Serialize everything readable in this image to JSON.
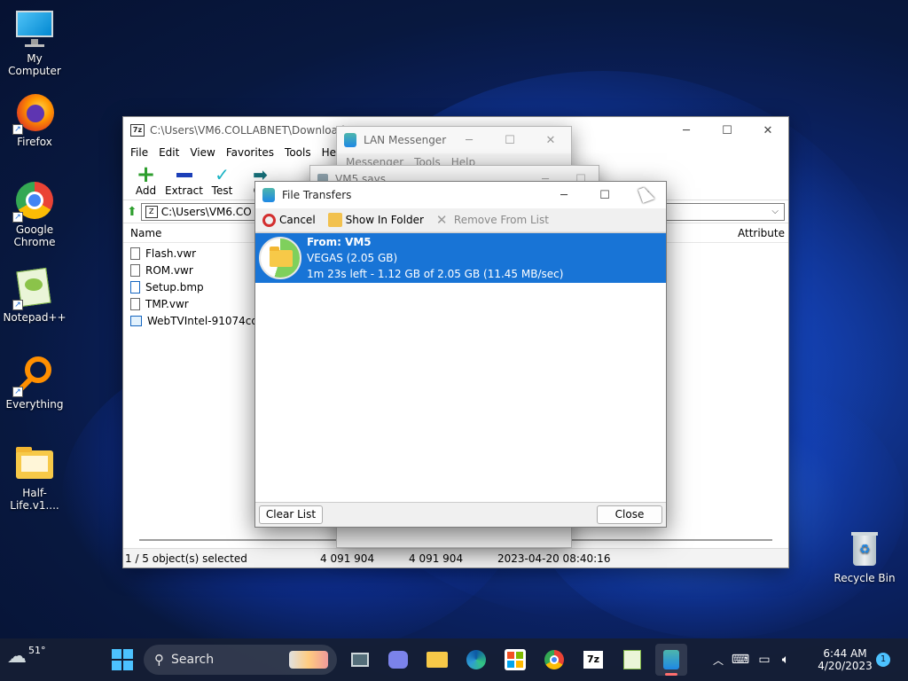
{
  "desktop": {
    "icons": [
      {
        "label": "My Computer"
      },
      {
        "label": "Firefox"
      },
      {
        "label": "Google Chrome"
      },
      {
        "label": "Notepad++"
      },
      {
        "label": "Everything"
      },
      {
        "label": "Half-Life.v1...."
      },
      {
        "label": "Recycle Bin"
      }
    ]
  },
  "sevenzip": {
    "title": "C:\\Users\\VM6.COLLABNET\\Downloads\\W...",
    "menu": [
      "File",
      "Edit",
      "View",
      "Favorites",
      "Tools",
      "Help"
    ],
    "toolbar": [
      "Add",
      "Extract",
      "Test",
      "Co"
    ],
    "address": "C:\\Users\\VM6.CO",
    "columns": {
      "name": "Name",
      "modified": "d",
      "attributes": "Attribute"
    },
    "files": [
      {
        "name": "Flash.vwr"
      },
      {
        "name": "ROM.vwr"
      },
      {
        "name": "Setup.bmp"
      },
      {
        "name": "TMP.vwr"
      },
      {
        "name": "WebTVIntel-91074cd6ae"
      }
    ],
    "status": {
      "selected": "1 / 5 object(s) selected",
      "size1": "4 091 904",
      "size2": "4 091 904",
      "date": "2023-04-20 08:40:16"
    }
  },
  "lan": {
    "title": "LAN Messenger",
    "menu": [
      "Messenger",
      "Tools",
      "Help"
    ]
  },
  "vm5": {
    "title": "VM5 says..."
  },
  "transfers": {
    "title": "File Transfers",
    "toolbar": {
      "cancel": "Cancel",
      "show_folder": "Show In Folder",
      "remove": "Remove From List"
    },
    "item": {
      "from": "From: VM5",
      "file": "VEGAS (2.05 GB)",
      "progress_text": "1m 23s left - 1.12 GB of 2.05 GB (11.45 MB/sec)",
      "progress_fraction": 0.546
    },
    "clear_list": "Clear List",
    "close": "Close"
  },
  "taskbar": {
    "weather": "51°",
    "search": "Search",
    "time": "6:44 AM",
    "date": "4/20/2023",
    "notifications": "1"
  }
}
